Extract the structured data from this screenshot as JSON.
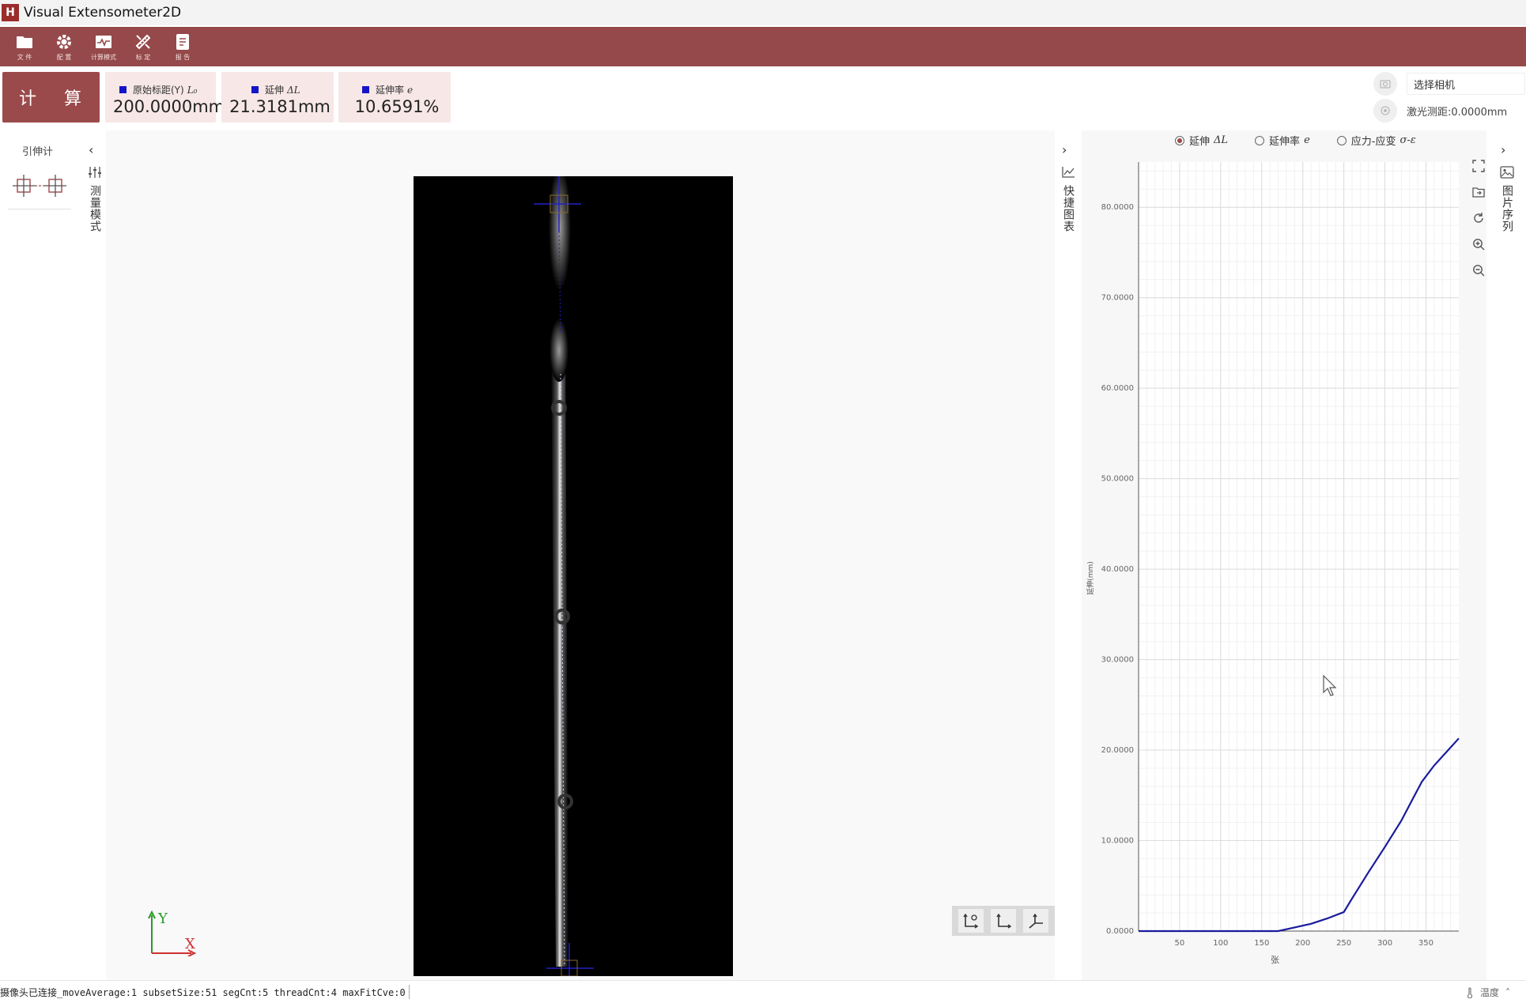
{
  "app": {
    "logo_text": "H",
    "title": "Visual Extensometer2D"
  },
  "toolbar": {
    "items": [
      {
        "label": "文 件",
        "icon": "folder-icon"
      },
      {
        "label": "配 置",
        "icon": "gear-icon"
      },
      {
        "label": "计算模式",
        "icon": "waveform-icon"
      },
      {
        "label": "标 定",
        "icon": "calibrate-icon"
      },
      {
        "label": "报 告",
        "icon": "report-icon"
      }
    ]
  },
  "compute": {
    "label": "计 算"
  },
  "metrics": [
    {
      "label": "原始标距(Y)",
      "symbol": "L₀",
      "value": "200.0000mm"
    },
    {
      "label": "延伸",
      "symbol": "ΔL",
      "value": "21.3181mm"
    },
    {
      "label": "延伸率",
      "symbol": "e",
      "value": "10.6591%"
    }
  ],
  "camera": {
    "select_label": "选择相机",
    "laser_text": "激光测距:0.0000mm"
  },
  "left_panel": {
    "title": "引伸计",
    "mode_label": "测量模式"
  },
  "quick_chart_label": "快捷图表",
  "image_sequence_label": "图片序列",
  "axis_labels": {
    "y": "Y",
    "x": "X"
  },
  "chart_options": [
    {
      "label": "延伸",
      "symbol": "ΔL",
      "selected": true
    },
    {
      "label": "延伸率",
      "symbol": "e",
      "selected": false
    },
    {
      "label": "应力-应变",
      "symbol": "σ-ε",
      "selected": false
    }
  ],
  "chart_data": {
    "type": "line",
    "xlabel": "张",
    "ylabel": "延伸(mm)",
    "xlim": [
      0,
      390
    ],
    "ylim": [
      0,
      85
    ],
    "x_ticks": [
      50,
      100,
      150,
      200,
      250,
      300,
      350
    ],
    "y_ticks": [
      "0.0000",
      "10.0000",
      "20.0000",
      "30.0000",
      "40.0000",
      "50.0000",
      "60.0000",
      "70.0000",
      "80.0000"
    ],
    "grid": true,
    "series": [
      {
        "color": "#1a1a9e",
        "x": [
          0,
          100,
          150,
          170,
          190,
          210,
          230,
          250,
          260,
          280,
          300,
          320,
          335,
          345,
          360,
          375,
          390
        ],
        "y": [
          0,
          0,
          0,
          0,
          0.4,
          0.8,
          1.4,
          2.1,
          3.6,
          6.5,
          9.3,
          12.2,
          14.8,
          16.5,
          18.3,
          19.8,
          21.3
        ]
      }
    ]
  },
  "status": {
    "text": "摄像头已连接_moveAverage:1  subsetSize:51  segCnt:5  threadCnt:4  maxFitCve:0",
    "right_label": "温度"
  }
}
